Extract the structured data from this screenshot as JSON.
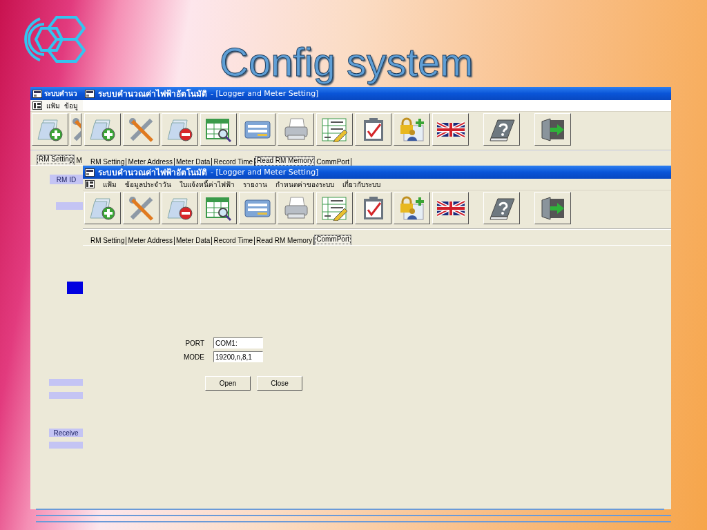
{
  "slide": {
    "title": "Config system"
  },
  "windows": [
    {
      "title": "ระบบคำนว",
      "menu": [
        "แฟ้ม",
        "ข้อมู"
      ],
      "toolbar": [
        [
          {
            "kind": "add-document"
          },
          {
            "kind": "tools"
          }
        ]
      ],
      "tabs": [
        {
          "label": "RM Setting",
          "selected": true
        },
        {
          "label": "M",
          "selected": false
        }
      ],
      "side_items": [
        {
          "kind": "label",
          "text": "RM ID"
        },
        {
          "kind": "bar"
        },
        {
          "kind": "swatch"
        },
        {
          "kind": "bar"
        },
        {
          "kind": "bar"
        },
        {
          "kind": "label",
          "text": "Receive"
        },
        {
          "kind": "bar"
        }
      ]
    },
    {
      "title": "ระบบคำนวณค่าไฟฟ้าอัตโนมัติ",
      "document": "- [Logger and Meter Setting]",
      "toolbar": [
        [
          {
            "kind": "add-document"
          },
          {
            "kind": "tools"
          },
          {
            "kind": "remove-document"
          },
          {
            "kind": "table-search"
          },
          {
            "kind": "form"
          },
          {
            "kind": "printer"
          },
          {
            "kind": "number-grid"
          },
          {
            "kind": "clipboard-check"
          },
          {
            "kind": "lock-user"
          },
          {
            "kind": "flag"
          }
        ],
        [
          {
            "kind": "help-book"
          }
        ],
        [
          {
            "kind": "exit-door"
          }
        ]
      ],
      "tabs": [
        {
          "label": "RM Setting",
          "selected": false
        },
        {
          "label": "Meter Address",
          "selected": false
        },
        {
          "label": "Meter Data",
          "selected": false
        },
        {
          "label": "Record Time",
          "selected": false
        },
        {
          "label": "Read RM Memory",
          "selected": true
        },
        {
          "label": "CommPort",
          "selected": false
        }
      ]
    },
    {
      "title": "ระบบคำนวณค่าไฟฟ้าอัตโนมัติ",
      "document": "- [Logger and Meter Setting]",
      "menu": [
        "แฟ้ม",
        "ข้อมูลประจำวัน",
        "ใบแจ้งหนี้ค่าไฟฟ้า",
        "รายงาน",
        "กำหนดค่าของระบบ",
        "เกี่ยวกับระบบ"
      ],
      "toolbar": [
        [
          {
            "kind": "add-document"
          },
          {
            "kind": "tools"
          },
          {
            "kind": "remove-document"
          },
          {
            "kind": "table-search"
          },
          {
            "kind": "form"
          },
          {
            "kind": "printer"
          },
          {
            "kind": "number-grid"
          },
          {
            "kind": "clipboard-check"
          },
          {
            "kind": "lock-user"
          },
          {
            "kind": "flag"
          }
        ],
        [
          {
            "kind": "help-book"
          }
        ],
        [
          {
            "kind": "exit-door"
          }
        ]
      ],
      "tabs": [
        {
          "label": "RM Setting",
          "selected": false
        },
        {
          "label": "Meter Address",
          "selected": false
        },
        {
          "label": "Meter Data",
          "selected": false
        },
        {
          "label": "Record Time",
          "selected": false
        },
        {
          "label": "Read RM Memory",
          "selected": false
        },
        {
          "label": "CommPort",
          "selected": true
        }
      ],
      "form": {
        "fields": [
          {
            "label": "PORT",
            "value": "COM1:"
          },
          {
            "label": "MODE",
            "value": "19200,n,8,1"
          }
        ],
        "buttons": [
          "Open",
          "Close"
        ]
      }
    }
  ]
}
